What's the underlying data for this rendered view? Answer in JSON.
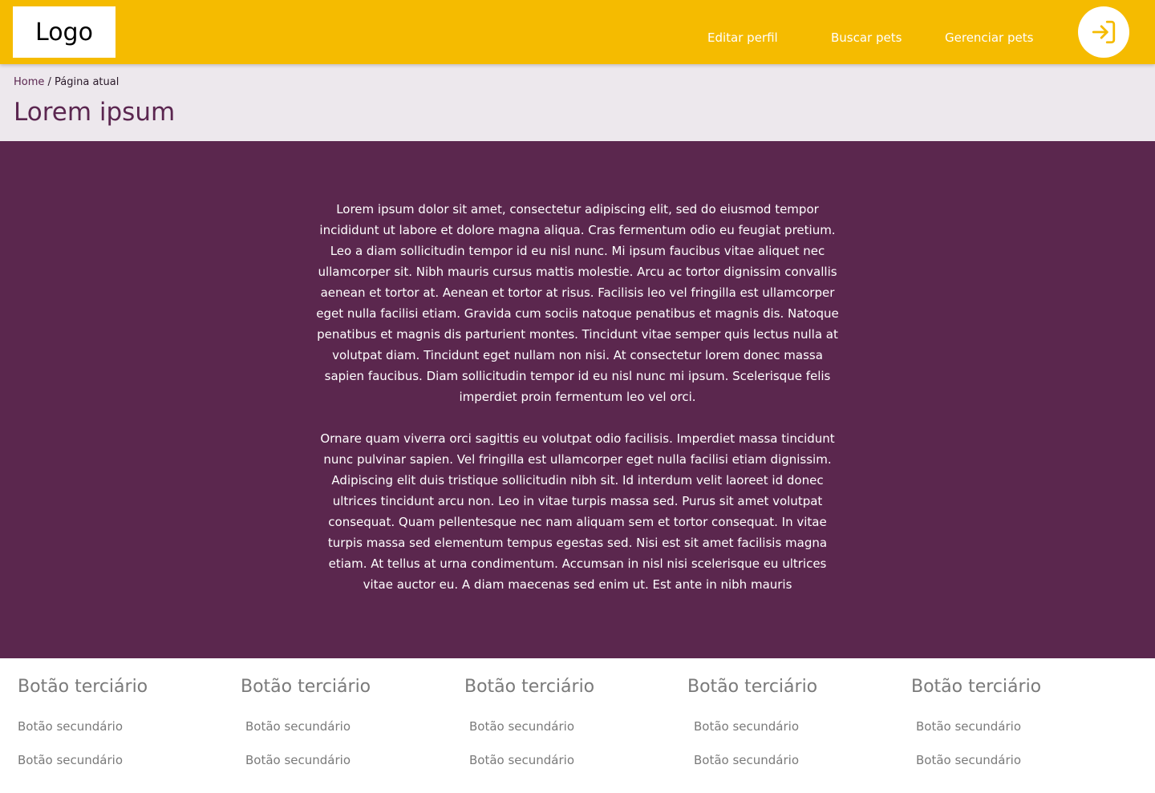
{
  "header": {
    "logo": "Logo",
    "nav": {
      "edit_profile": "Editar perfil",
      "search_pets": "Buscar pets",
      "manage_pets": "Gerenciar pets"
    },
    "login_icon": "login-icon"
  },
  "breadcrumb": {
    "home": "Home",
    "separator": " / ",
    "current": "Página atual"
  },
  "page_title": "Lorem ipsum",
  "content": {
    "paragraphs": [
      "Lorem ipsum dolor sit amet, consectetur adipiscing elit, sed do eiusmod tempor incididunt ut labore et dolore magna aliqua. Cras fermentum odio eu feugiat pretium. Leo a diam sollicitudin tempor id eu nisl nunc. Mi ipsum faucibus vitae aliquet nec ullamcorper sit. Nibh mauris cursus mattis molestie. Arcu ac tortor dignissim convallis aenean et tortor at. Aenean et tortor at risus. Facilisis leo vel fringilla est ullamcorper eget nulla facilisi etiam. Gravida cum sociis natoque penatibus et magnis dis. Natoque penatibus et magnis dis parturient montes. Tincidunt vitae semper quis lectus nulla at volutpat diam. Tincidunt eget nullam non nisi. At consectetur lorem donec massa sapien faucibus. Diam sollicitudin tempor id eu nisl nunc mi ipsum. Scelerisque felis imperdiet proin fermentum leo vel orci.",
      "Ornare quam viverra orci sagittis eu volutpat odio facilisis. Imperdiet massa tincidunt nunc pulvinar sapien. Vel fringilla est ullamcorper eget nulla facilisi etiam dignissim. Adipiscing elit duis tristique sollicitudin nibh sit. Id interdum velit laoreet id donec ultrices tincidunt arcu non. Leo in vitae turpis massa sed. Purus sit amet volutpat consequat. Quam pellentesque nec nam aliquam sem et tortor consequat. In vitae turpis massa sed elementum tempus egestas sed. Nisi est sit amet facilisis magna etiam. At tellus at urna condimentum. Accumsan in nisl nisi scelerisque eu ultrices vitae auctor eu. A diam maecenas sed enim ut. Est ante in nibh mauris"
    ]
  },
  "footer": {
    "columns": [
      {
        "title": "Botão terciário",
        "links": [
          "Botão secundário",
          "Botão secundário"
        ]
      },
      {
        "title": "Botão terciário",
        "links": [
          "Botão secundário",
          "Botão secundário"
        ]
      },
      {
        "title": "Botão terciário",
        "links": [
          "Botão secundário",
          "Botão secundário"
        ]
      },
      {
        "title": "Botão terciário",
        "links": [
          "Botão secundário",
          "Botão secundário"
        ]
      },
      {
        "title": "Botão terciário",
        "links": [
          "Botão secundário",
          "Botão secundário"
        ]
      }
    ]
  },
  "colors": {
    "header_bg": "#f5bb00",
    "subheader_bg": "#ede8ed",
    "content_bg": "#5b274e",
    "accent_purple": "#5b2650",
    "footer_text": "#7a7a7a"
  }
}
